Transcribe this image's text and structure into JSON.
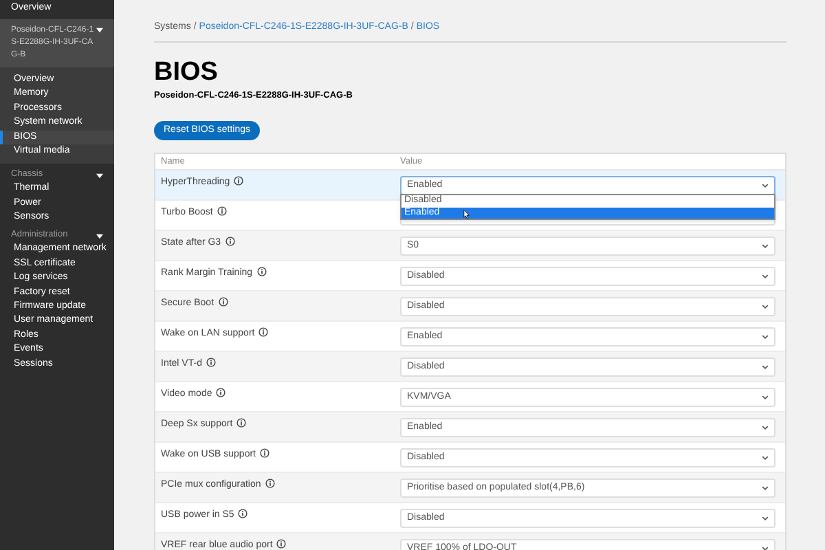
{
  "sidebar": {
    "top_item": "Overview",
    "groups": [
      {
        "kind": "system",
        "title": "Poseidon-CFL-C246-1S-E2288G-IH-3UF-CAG-B",
        "expanded": true,
        "items": [
          {
            "label": "Overview",
            "selected": false
          },
          {
            "label": "Memory",
            "selected": false
          },
          {
            "label": "Processors",
            "selected": false
          },
          {
            "label": "System network",
            "selected": false
          },
          {
            "label": "BIOS",
            "selected": true
          },
          {
            "label": "Virtual media",
            "selected": false
          }
        ]
      },
      {
        "kind": "section",
        "title": "Chassis",
        "expanded": true,
        "items": [
          {
            "label": "Thermal",
            "selected": false
          },
          {
            "label": "Power",
            "selected": false
          },
          {
            "label": "Sensors",
            "selected": false
          }
        ]
      },
      {
        "kind": "section",
        "title": "Administration",
        "expanded": true,
        "items": [
          {
            "label": "Management network",
            "selected": false
          },
          {
            "label": "SSL certificate",
            "selected": false
          },
          {
            "label": "Log services",
            "selected": false
          },
          {
            "label": "Factory reset",
            "selected": false
          },
          {
            "label": "Firmware update",
            "selected": false
          },
          {
            "label": "User management",
            "selected": false
          },
          {
            "label": "Roles",
            "selected": false
          },
          {
            "label": "Events",
            "selected": false
          },
          {
            "label": "Sessions",
            "selected": false
          }
        ]
      }
    ]
  },
  "breadcrumb_separator": "/",
  "breadcrumb": [
    {
      "label": "Systems",
      "link": false
    },
    {
      "label": "Poseidon-CFL-C246-1S-E2288G-IH-3UF-CAG-B",
      "link": true
    },
    {
      "label": "BIOS",
      "link": true
    }
  ],
  "title": "BIOS",
  "subtitle": "Poseidon-CFL-C246-1S-E2288G-IH-3UF-CAG-B",
  "reset_button": "Reset BIOS settings",
  "table": {
    "columns": [
      "Name",
      "Value"
    ],
    "rows": [
      {
        "name": "HyperThreading",
        "value": "Enabled",
        "hovered": true,
        "dropdown": [
          {
            "label": "Disabled",
            "selected": false
          },
          {
            "label": "Enabled",
            "selected": true
          }
        ]
      },
      {
        "name": "Turbo Boost",
        "hovered": false
      },
      {
        "name": "State after G3",
        "value": "S0",
        "hovered": false
      },
      {
        "name": "Rank Margin Training",
        "value": "Disabled",
        "hovered": false
      },
      {
        "name": "Secure Boot",
        "value": "Disabled",
        "hovered": false
      },
      {
        "name": "Wake on LAN support",
        "value": "Enabled",
        "hovered": false
      },
      {
        "name": "Intel VT-d",
        "value": "Disabled",
        "hovered": false
      },
      {
        "name": "Video mode",
        "value": "KVM/VGA",
        "hovered": false
      },
      {
        "name": "Deep Sx support",
        "value": "Enabled",
        "hovered": false
      },
      {
        "name": "Wake on USB support",
        "value": "Disabled",
        "hovered": false
      },
      {
        "name": "PCIe mux configuration",
        "value": "Prioritise based on populated slot(4,PB,6)",
        "hovered": false
      },
      {
        "name": "USB power in S5",
        "value": "Disabled",
        "hovered": false
      },
      {
        "name": "VREF rear blue audio port",
        "value": "VREF 100% of LDO-OUT",
        "hovered": false
      }
    ]
  }
}
